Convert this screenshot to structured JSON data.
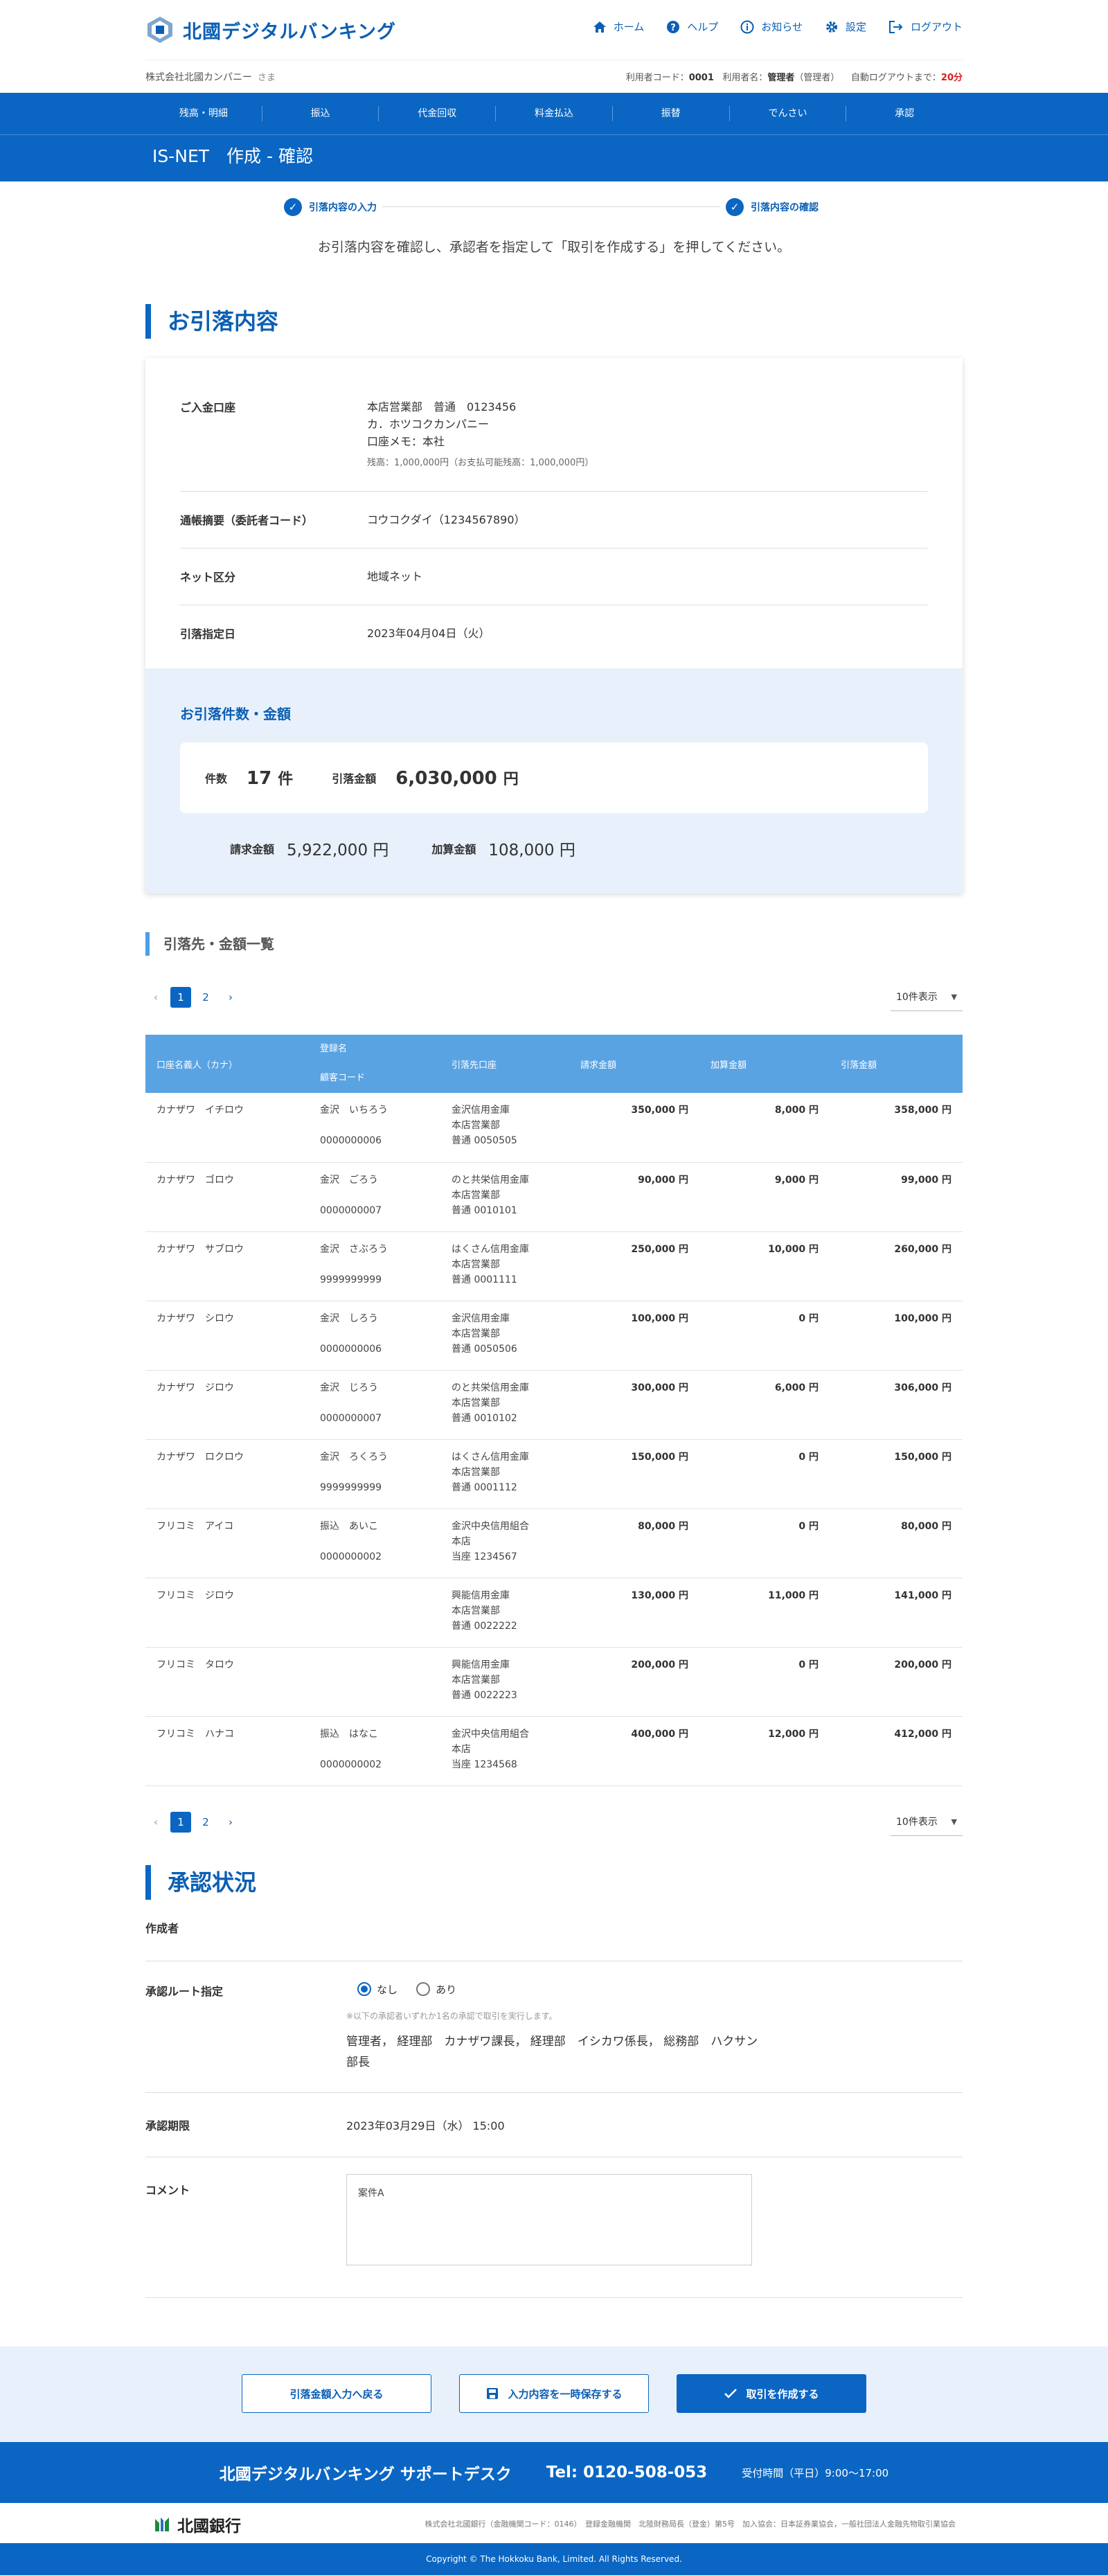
{
  "header": {
    "logo_text": "北國デジタルバンキング",
    "nav": [
      {
        "label": "ホーム",
        "icon": "home-icon"
      },
      {
        "label": "ヘルプ",
        "icon": "help-icon"
      },
      {
        "label": "お知らせ",
        "icon": "info-icon"
      },
      {
        "label": "設定",
        "icon": "gear-icon"
      },
      {
        "label": "ログアウト",
        "icon": "logout-icon"
      }
    ],
    "company": "株式会社北國カンパニー",
    "company_suffix": "さま",
    "user_code_label": "利用者コード：",
    "user_code": "0001",
    "user_name_label": "利用者名：",
    "user_name": "管理者",
    "user_role": "（管理者）",
    "auto_logout_label": "自動ログアウトまで：",
    "auto_logout": "20分"
  },
  "global_nav": [
    "残高・明細",
    "振込",
    "代金回収",
    "料金払込",
    "振替",
    "でんさい",
    "承認"
  ],
  "page_title": "IS-NET　作成 - 確認",
  "steps": [
    "引落内容の入力",
    "引落内容の確認"
  ],
  "lead": "お引落内容を確認し、承認者を指定して「取引を作成する」を押してください。",
  "details": {
    "heading": "お引落内容",
    "account_label": "ご入金口座",
    "account_line1": "本店営業部　普通　0123456",
    "account_line2": "カ．ホツコクカンパニー",
    "account_line3": "口座メモ：本社",
    "account_balance": "残高：1,000,000円（お支払可能残高：1,000,000円）",
    "summary_label": "通帳摘要（委託者コード）",
    "summary_value": "コウコクダイ（1234567890）",
    "network_label": "ネット区分",
    "network_value": "地域ネット",
    "date_label": "引落指定日",
    "date_value": "2023年04月04日（火）"
  },
  "totals": {
    "heading": "お引落件数・金額",
    "count_label": "件数",
    "count_value": "17",
    "count_unit": "件",
    "amount_label": "引落金額",
    "amount_value": "6,030,000",
    "amount_unit": "円",
    "billing_label": "請求金額",
    "billing_value": "5,922,000",
    "billing_unit": "円",
    "fee_label": "加算金額",
    "fee_value": "108,000",
    "fee_unit": "円"
  },
  "list": {
    "heading": "引落先・金額一覧",
    "pages": [
      "1",
      "2"
    ],
    "per_page": "10件表示",
    "headers": {
      "holder": "口座名義人（カナ）",
      "reg_name": "登録名",
      "cust_code": "顧客コード",
      "bank": "引落先口座",
      "billing": "請求金額",
      "fee": "加算金額",
      "amount": "引落金額"
    },
    "rows": [
      {
        "holder": "カナザワ　イチロウ",
        "reg": "金沢　いちろう",
        "code": "0000000006",
        "bank1": "金沢信用金庫",
        "bank2": "本店営業部",
        "bank3": "普通 0050505",
        "billing": "350,000 円",
        "fee": "8,000 円",
        "amount": "358,000 円"
      },
      {
        "holder": "カナザワ　ゴロウ",
        "reg": "金沢　ごろう",
        "code": "0000000007",
        "bank1": "のと共栄信用金庫",
        "bank2": "本店営業部",
        "bank3": "普通 0010101",
        "billing": "90,000 円",
        "fee": "9,000 円",
        "amount": "99,000 円"
      },
      {
        "holder": "カナザワ　サブロウ",
        "reg": "金沢　さぶろう",
        "code": "9999999999",
        "bank1": "はくさん信用金庫",
        "bank2": "本店営業部",
        "bank3": "普通 0001111",
        "billing": "250,000 円",
        "fee": "10,000 円",
        "amount": "260,000 円"
      },
      {
        "holder": "カナザワ　シロウ",
        "reg": "金沢　しろう",
        "code": "0000000006",
        "bank1": "金沢信用金庫",
        "bank2": "本店営業部",
        "bank3": "普通 0050506",
        "billing": "100,000 円",
        "fee": "0 円",
        "amount": "100,000 円"
      },
      {
        "holder": "カナザワ　ジロウ",
        "reg": "金沢　じろう",
        "code": "0000000007",
        "bank1": "のと共栄信用金庫",
        "bank2": "本店営業部",
        "bank3": "普通 0010102",
        "billing": "300,000 円",
        "fee": "6,000 円",
        "amount": "306,000 円"
      },
      {
        "holder": "カナザワ　ロクロウ",
        "reg": "金沢　ろくろう",
        "code": "9999999999",
        "bank1": "はくさん信用金庫",
        "bank2": "本店営業部",
        "bank3": "普通 0001112",
        "billing": "150,000 円",
        "fee": "0 円",
        "amount": "150,000 円"
      },
      {
        "holder": "フリコミ　アイコ",
        "reg": "振込　あいこ",
        "code": "0000000002",
        "bank1": "金沢中央信用組合",
        "bank2": "本店",
        "bank3": "当座 1234567",
        "billing": "80,000 円",
        "fee": "0 円",
        "amount": "80,000 円"
      },
      {
        "holder": "フリコミ　ジロウ",
        "reg": "",
        "code": "",
        "bank1": "興能信用金庫",
        "bank2": "本店営業部",
        "bank3": "普通 0022222",
        "billing": "130,000 円",
        "fee": "11,000 円",
        "amount": "141,000 円"
      },
      {
        "holder": "フリコミ　タロウ",
        "reg": "",
        "code": "",
        "bank1": "興能信用金庫",
        "bank2": "本店営業部",
        "bank3": "普通 0022223",
        "billing": "200,000 円",
        "fee": "0 円",
        "amount": "200,000 円"
      },
      {
        "holder": "フリコミ　ハナコ",
        "reg": "振込　はなこ",
        "code": "0000000002",
        "bank1": "金沢中央信用組合",
        "bank2": "本店",
        "bank3": "当座 1234568",
        "billing": "400,000 円",
        "fee": "12,000 円",
        "amount": "412,000 円"
      }
    ]
  },
  "approval": {
    "heading": "承認状況",
    "creator_label": "作成者",
    "route_label": "承認ルート指定",
    "radio_none": "なし",
    "radio_yes": "あり",
    "note": "※以下の承認者いずれか1名の承認で取引を実行します。",
    "route_text": "管理者， 経理部　カナザワ課長， 経理部　イシカワ係長， 総務部　ハクサン部長",
    "time_label": "承認期限",
    "time_value": "2023年03月29日（水） 15:00",
    "comment_label": "コメント",
    "comment_value": "案件A"
  },
  "actions": {
    "back": "引落金額入力へ戻る",
    "save": "入力内容を一時保存する",
    "create": "取引を作成する"
  },
  "footer": {
    "support_title": "北國デジタルバンキング サポートデスク",
    "tel": "Tel: 0120-508-053",
    "hours": "受付時間（平日）9:00〜17:00",
    "bank_name": "北國銀行",
    "registration": "株式会社北國銀行（金融機関コード：0146）　登録金融機関　北陸財務局長（登金）第5号　加入協会：日本証券業協会，一般社団法人金融先物取引業協会",
    "copyright": "Copyright © The Hokkoku Bank, Limited. All Rights Reserved."
  }
}
